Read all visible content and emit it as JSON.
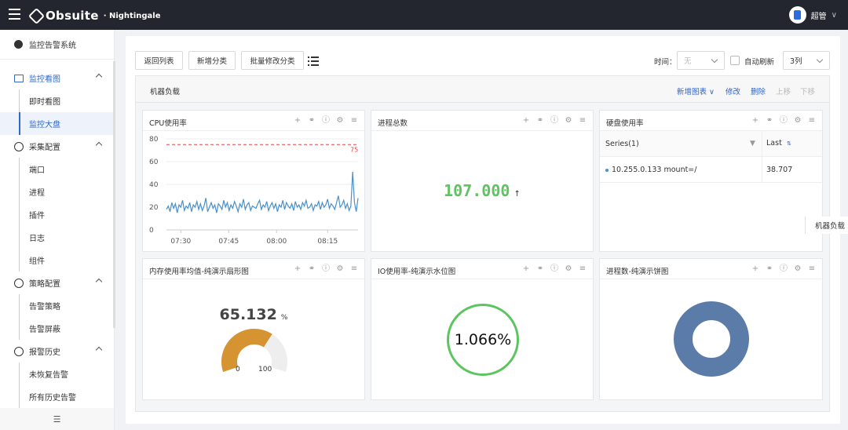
{
  "header": {
    "brand": "Obsuite",
    "brand_sub": "· Nightingale",
    "user": "超管",
    "user_caret": "∨"
  },
  "sidebar": {
    "title": "监控告警系统",
    "groups": [
      {
        "label": "监控看图",
        "items": [
          "即时看图",
          "监控大盘"
        ]
      },
      {
        "label": "采集配置",
        "items": [
          "端口",
          "进程",
          "插件",
          "日志",
          "组件"
        ]
      },
      {
        "label": "策略配置",
        "items": [
          "告警策略",
          "告警屏蔽"
        ]
      },
      {
        "label": "报警历史",
        "items": [
          "未恢复告警",
          "所有历史告警"
        ]
      }
    ],
    "active_item": "监控大盘"
  },
  "toolbar": {
    "back": "返回列表",
    "add_category": "新增分类",
    "batch_edit": "批量修改分类",
    "time_label": "时间：",
    "time_value": "无",
    "auto_refresh": "自动刷新",
    "columns": "3列"
  },
  "group": {
    "title": "机器负载",
    "add_chart": "新增图表 ∨",
    "edit": "修改",
    "delete": "删除",
    "move_up": "上移",
    "move_down": "下移"
  },
  "side_tab": "机器负载",
  "panels": {
    "cpu": {
      "title": "CPU使用率"
    },
    "proc_total": {
      "title": "进程总数",
      "value": "107.000",
      "arrow": "↑"
    },
    "disk": {
      "title": "硬盘使用率",
      "col_series": "Series(1)",
      "col_last": "Last",
      "row_series": "10.255.0.133 mount=/",
      "row_last": "38.707"
    },
    "mem": {
      "title": "内存使用率均值-纯演示扇形图",
      "value": "65.132",
      "unit": "%",
      "min": "0",
      "max": "100"
    },
    "io": {
      "title": "IO使用率-纯演示水位图",
      "value": "1.066%"
    },
    "proc_pie": {
      "title": "进程数-纯演示饼图"
    }
  },
  "gauge_fraction": 0.65132,
  "colors": {
    "accent": "#2f67ce",
    "green": "#5cc55f",
    "orange": "#d59431",
    "line": "#4a90c9",
    "threshold": "#e54545",
    "pie": "#5b7ba8"
  },
  "chart_data": {
    "type": "line",
    "title": "CPU使用率",
    "x_ticks": [
      "07:30",
      "07:45",
      "08:00",
      "08:15"
    ],
    "y_ticks": [
      0,
      20,
      40,
      60,
      80
    ],
    "ylim": [
      0,
      80
    ],
    "threshold": 75,
    "threshold_label": "75",
    "grid": true,
    "series": [
      {
        "values": [
          18,
          21,
          16,
          24,
          19,
          23,
          15,
          22,
          20,
          26,
          17,
          21,
          19,
          24,
          16,
          22,
          20,
          25,
          18,
          23,
          17,
          21,
          28,
          16,
          20,
          24,
          19,
          22,
          15,
          23,
          21,
          18,
          26,
          20,
          24,
          17,
          22,
          19,
          25,
          21,
          16,
          23,
          20,
          27,
          18,
          22,
          24,
          17,
          21,
          20,
          19,
          23,
          26,
          18,
          22,
          20,
          25,
          17,
          21,
          24,
          19,
          23,
          16,
          22,
          20,
          26,
          18,
          24,
          21,
          19,
          23,
          17,
          25,
          20,
          22,
          18,
          24,
          21,
          26,
          19,
          20,
          23,
          17,
          22,
          21,
          25,
          18,
          24,
          20,
          22,
          27,
          19,
          23,
          21,
          18,
          24,
          30,
          20,
          22,
          26,
          19,
          23,
          17,
          21,
          51,
          24,
          16,
          28
        ]
      }
    ]
  }
}
